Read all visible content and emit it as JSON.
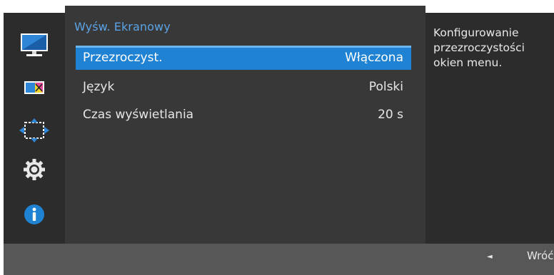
{
  "panel": {
    "title": "Wyśw. Ekranowy"
  },
  "sidebar": {
    "items": [
      {
        "icon": "monitor-icon"
      },
      {
        "icon": "color-icon"
      },
      {
        "icon": "size-position-icon"
      },
      {
        "icon": "gear-icon"
      },
      {
        "icon": "info-icon"
      }
    ]
  },
  "menu": {
    "items": [
      {
        "label": "Przezroczyst.",
        "value": "Włączona",
        "selected": true
      },
      {
        "label": "Język",
        "value": "Polski",
        "selected": false
      },
      {
        "label": "Czas wyświetlania",
        "value": "20 s",
        "selected": false
      }
    ]
  },
  "description": {
    "line1": "Konfigurowanie",
    "line2": "przezroczystości",
    "line3": "okien menu."
  },
  "footer": {
    "back_arrow": "◄",
    "back_label": "Wróć"
  },
  "colors": {
    "accent": "#1f82d2",
    "title": "#5ba3e6",
    "panel_bg": "#383838",
    "sidebar_bg": "#2c2c2c",
    "footer_bg": "#575757"
  }
}
